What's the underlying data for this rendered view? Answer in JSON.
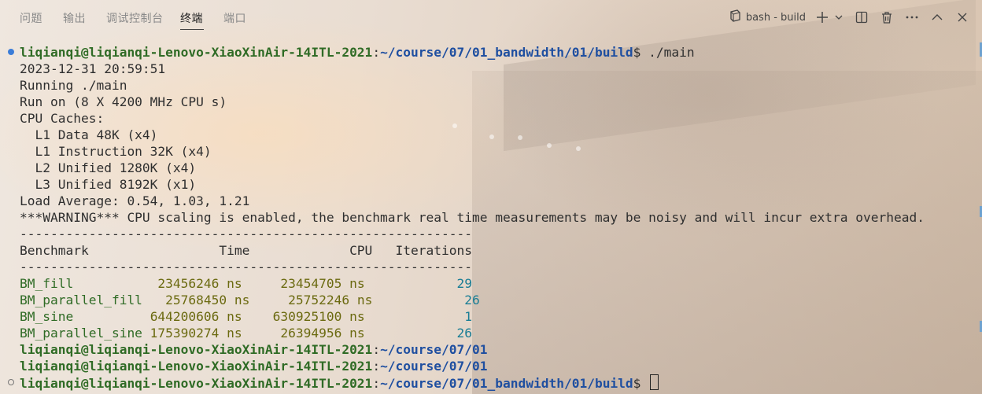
{
  "panel": {
    "tabs": [
      {
        "label": "问题"
      },
      {
        "label": "输出"
      },
      {
        "label": "调试控制台"
      },
      {
        "label": "终端"
      },
      {
        "label": "端口"
      }
    ],
    "active_tab": "终端",
    "terminal_name": "bash - build",
    "icons": [
      "terminal-icon",
      "plus-icon",
      "chevron-down-icon",
      "split-icon",
      "trash-icon",
      "more-icon",
      "maximize-icon",
      "close-icon"
    ]
  },
  "terminal": {
    "prompt_user": "liqianqi@liqianqi-Lenovo-XiaoXinAir-14ITL-2021",
    "prompt_colon": ":",
    "prompt_path_build": "~/course/07/01_bandwidth/01/build",
    "prompt_path_short": "~/course/07/01",
    "prompt_dollar": "$",
    "command": " ./main",
    "output_lines": [
      "2023-12-31 20:59:51",
      "Running ./main",
      "Run on (8 X 4200 MHz CPU s)",
      "CPU Caches:",
      "  L1 Data 48K (x4)",
      "  L1 Instruction 32K (x4)",
      "  L2 Unified 1280K (x4)",
      "  L3 Unified 8192K (x1)",
      "Load Average: 0.54, 1.03, 1.21",
      "***WARNING*** CPU scaling is enabled, the benchmark real time measurements may be noisy and will incur extra overhead.",
      "-----------------------------------------------------------",
      "Benchmark                 Time             CPU   Iterations",
      "-----------------------------------------------------------"
    ],
    "benchmarks": [
      {
        "name": "BM_fill",
        "time": "           23456246 ns     23454705 ns   ",
        "iterations": "         29"
      },
      {
        "name": "BM_parallel_fill",
        "time": "   25768450 ns     25752246 ns   ",
        "iterations": "         26"
      },
      {
        "name": "BM_sine",
        "time": "          644200606 ns    630925100 ns   ",
        "iterations": "          1"
      },
      {
        "name": "BM_parallel_sine",
        "time": " 175390274 ns     26394956 ns   ",
        "iterations": "         26"
      }
    ]
  },
  "colors": {
    "prompt_user": "#2f6b25",
    "prompt_path": "#1f4fa0",
    "bench_values": "#6b6a10",
    "iterations": "#197d95"
  }
}
